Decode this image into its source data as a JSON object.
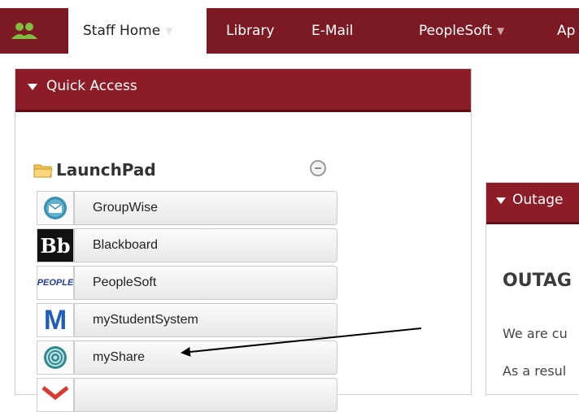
{
  "nav": {
    "tabs": [
      {
        "label": "Staff Home"
      },
      {
        "label": "Library"
      },
      {
        "label": "E-Mail"
      },
      {
        "label": "PeopleSoft"
      },
      {
        "label": "Ap"
      }
    ]
  },
  "quick_access": {
    "title": "Quick Access",
    "launchpad_title": "LaunchPad",
    "items": [
      {
        "label": "GroupWise",
        "icon": "groupwise-icon"
      },
      {
        "label": "Blackboard",
        "icon": "blackboard-icon"
      },
      {
        "label": "PeopleSoft",
        "icon": "peoplesoft-icon"
      },
      {
        "label": "myStudentSystem",
        "icon": "mystudentsystem-icon"
      },
      {
        "label": "myShare",
        "icon": "myshare-icon"
      },
      {
        "label": "",
        "icon": "gmail-icon"
      }
    ],
    "icon_texts": {
      "blackboard": "Bb",
      "peoplesoft": "PEOPLE",
      "mystudentsystem": "M"
    }
  },
  "outage": {
    "title": "Outage",
    "heading": "OUTAG",
    "line1": "We are cu",
    "line2": "As a resul"
  },
  "colors": {
    "brand": "#8c1d26",
    "nav": "#7b1a22"
  }
}
